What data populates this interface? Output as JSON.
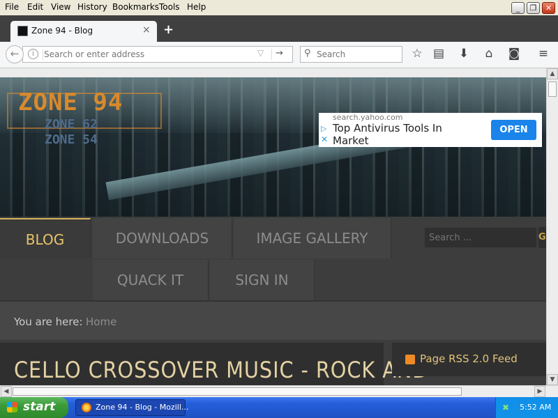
{
  "menubar": {
    "items": [
      "File",
      "Edit",
      "View",
      "History",
      "Bookmarks",
      "Tools",
      "Help"
    ]
  },
  "tab": {
    "title": "Zone 94 - Blog",
    "close": "×",
    "new_tab": "+"
  },
  "nav": {
    "url_placeholder": "Search or enter address",
    "search_placeholder": "Search",
    "back_icon": "←",
    "go_icon": "→"
  },
  "banner": {
    "logo_main": "ZONE 94",
    "logo_sub1": "ZONE 62",
    "logo_sub2": "ZONE 54"
  },
  "ad": {
    "domain": "search.yahoo.com",
    "text": "Top Antivirus Tools In Market",
    "button": "OPEN"
  },
  "site_nav": {
    "blog": "BLOG",
    "downloads": "DOWNLOADS",
    "gallery": "IMAGE GALLERY",
    "quack": "QUACK IT",
    "signin": "SIGN IN",
    "search_placeholder": "Search ...",
    "search_button": "G"
  },
  "breadcrumb": {
    "label": "You are here:",
    "home": "Home"
  },
  "post": {
    "title": "CELLO CROSSOVER MUSIC - ROCK AND"
  },
  "sidebar": {
    "rss_label": "Page RSS 2.0 Feed"
  },
  "taskbar": {
    "start": "start",
    "task_label": "Zone 94 - Blog - Mozill...",
    "clock": "5:52 AM"
  },
  "colors": {
    "accent_gold": "#e9c46a",
    "ad_button": "#1a84ea",
    "rss_orange": "#f08a24"
  }
}
